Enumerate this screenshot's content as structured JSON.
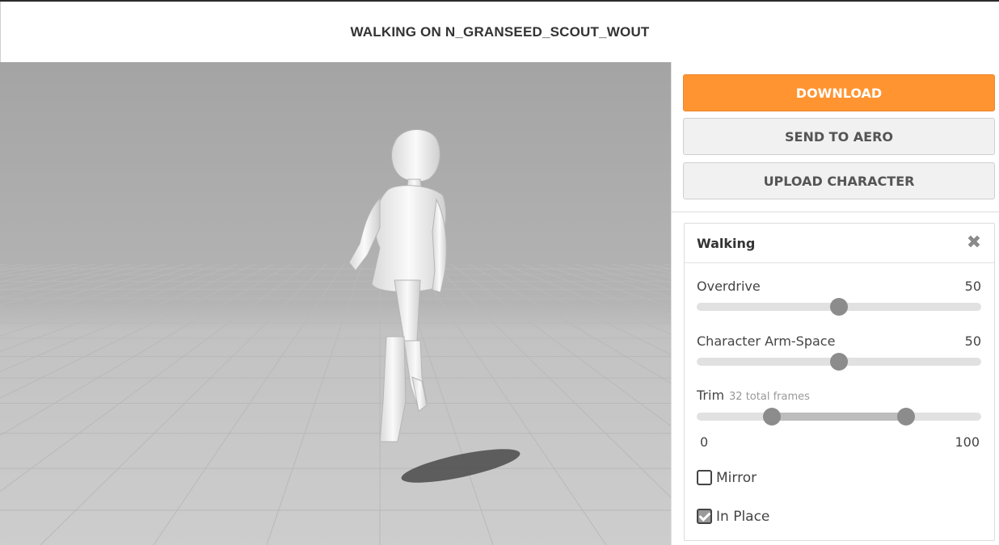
{
  "header": {
    "title": "WALKING ON N_GRANSEED_SCOUT_WOUT"
  },
  "actions": {
    "download_label": "DOWNLOAD",
    "send_label": "SEND TO AERO",
    "upload_label": "UPLOAD CHARACTER"
  },
  "settings": {
    "title": "Walking",
    "overdrive": {
      "label": "Overdrive",
      "value": "50",
      "fraction": 0.5
    },
    "arm_space": {
      "label": "Character Arm-Space",
      "value": "50",
      "fraction": 0.5
    },
    "trim": {
      "label": "Trim",
      "sub": "32 total frames",
      "min": "0",
      "max": "100",
      "start_fraction": 0.265,
      "end_fraction": 0.735
    },
    "mirror": {
      "label": "Mirror",
      "checked": false
    },
    "in_place": {
      "label": "In Place",
      "checked": true
    }
  },
  "colors": {
    "accent": "#ff9430",
    "thumb": "#8c8c8c",
    "track": "#e1e1e1"
  },
  "icons": {
    "close": "close-icon"
  }
}
